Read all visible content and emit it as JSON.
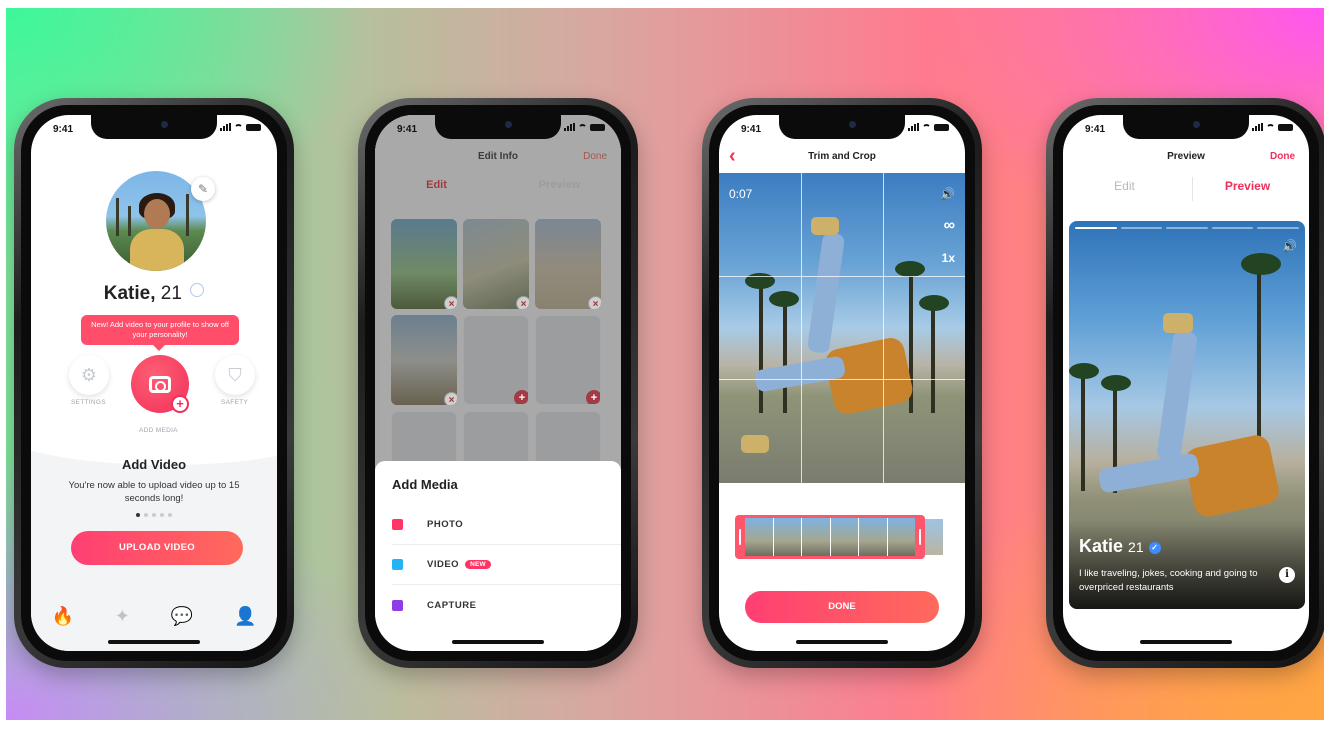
{
  "status_time": "9:41",
  "phone1": {
    "name": "Katie,",
    "age": "21",
    "tooltip": "New! Add video to your profile to show off your personality!",
    "settings_label": "SETTINGS",
    "safety_label": "SAFETY",
    "add_media_label": "ADD MEDIA",
    "card_title": "Add Video",
    "card_desc": "You're now able to upload video up to 15 seconds long!",
    "upload_label": "UPLOAD VIDEO"
  },
  "phone2": {
    "title": "Edit Info",
    "done": "Done",
    "tabs": [
      "Edit",
      "Preview"
    ],
    "sheet_title": "Add Media",
    "options": [
      {
        "label": "PHOTO",
        "color": "#ff3565"
      },
      {
        "label": "VIDEO",
        "color": "#24b3f4",
        "badge": "NEW"
      },
      {
        "label": "CAPTURE",
        "color": "#8e3ce8"
      }
    ]
  },
  "phone3": {
    "title": "Trim and Crop",
    "time": "0:07",
    "loop": "∞",
    "speed": "1x",
    "done_label": "DONE"
  },
  "phone4": {
    "title": "Preview",
    "done": "Done",
    "tabs": [
      "Edit",
      "Preview"
    ],
    "name": "Katie",
    "age": "21",
    "bio": "I like traveling, jokes, cooking and going to overpriced restaurants"
  },
  "colors": {
    "accent": "#f0305b",
    "verified": "#3f8cff"
  }
}
